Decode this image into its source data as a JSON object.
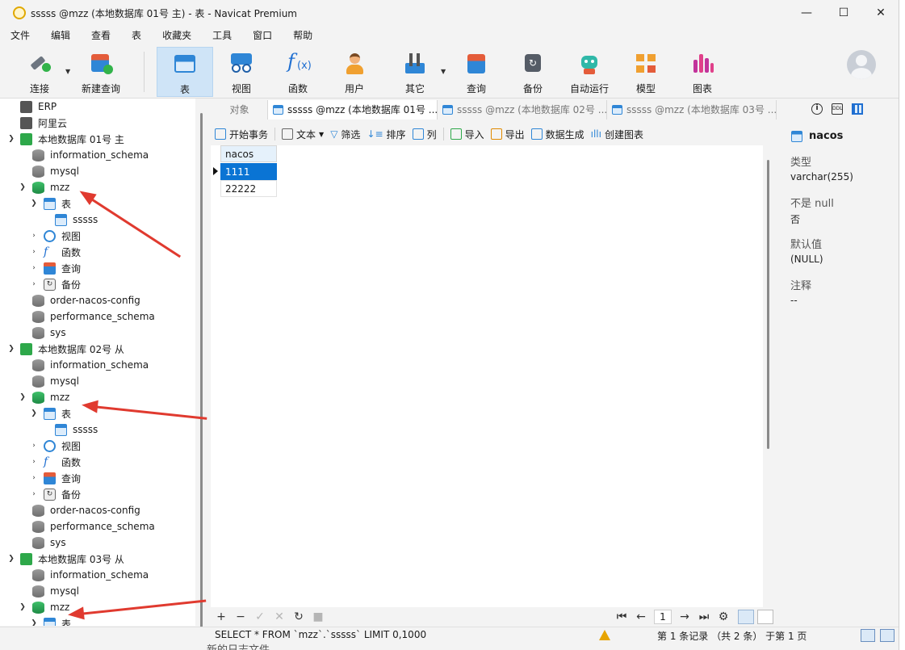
{
  "window": {
    "title": "sssss @mzz (本地数据库 01号 主) - 表 - Navicat Premium",
    "controls": {
      "minimize": "—",
      "maximize": "☐",
      "close": "✕"
    }
  },
  "menu": [
    "文件",
    "编辑",
    "查看",
    "表",
    "收藏夹",
    "工具",
    "窗口",
    "帮助"
  ],
  "toolbar": {
    "connect": "连接",
    "new_query": "新建查询",
    "table": "表",
    "view": "视图",
    "function": "函数",
    "user": "用户",
    "other": "其它",
    "query": "查询",
    "backup": "备份",
    "automation": "自动运行",
    "model": "模型",
    "chart": "图表"
  },
  "tree": {
    "erp": "ERP",
    "aliyun": "阿里云",
    "c1": "本地数据库 01号 主",
    "c2": "本地数据库 02号 从",
    "c3": "本地数据库 03号 从",
    "information_schema": "information_schema",
    "mysql": "mysql",
    "mzz": "mzz",
    "tables": "表",
    "sssss": "sssss",
    "views": "视图",
    "functions": "函数",
    "queries": "查询",
    "backups": "备份",
    "order_nacos_config": "order-nacos-config",
    "performance_schema": "performance_schema",
    "sys": "sys"
  },
  "tabs": [
    {
      "label": "对象"
    },
    {
      "label": "sssss @mzz (本地数据库 01号 ..."
    },
    {
      "label": "sssss @mzz (本地数据库 02号 ..."
    },
    {
      "label": "sssss @mzz (本地数据库 03号 ..."
    }
  ],
  "object_toolbar": {
    "begin_tx": "开始事务",
    "text": "文本",
    "filter": "筛选",
    "sort": "排序",
    "columns": "列",
    "import": "导入",
    "export": "导出",
    "data_gen": "数据生成",
    "create_chart": "创建图表"
  },
  "grid": {
    "header": "nacos",
    "rows": [
      "1111",
      "22222"
    ]
  },
  "grid_bar": {
    "add": "+",
    "remove": "−",
    "apply": "✓",
    "discard": "✕",
    "refresh": "↻",
    "stop": "■",
    "first": "⏮",
    "prev": "←",
    "page": "1",
    "next": "→",
    "last": "⏭",
    "settings": "⚙"
  },
  "status": {
    "sql": "SELECT * FROM `mzz`.`sssss` LIMIT 0,1000",
    "records": "第 1 条记录 （共 2 条） 于第 1 页"
  },
  "bleed_text": "新的日志文件。",
  "right_panel": {
    "field_name": "nacos",
    "type_label": "类型",
    "type_value": "varchar(255)",
    "notnull_label": "不是 null",
    "notnull_value": "否",
    "default_label": "默认值",
    "default_value": "(NULL)",
    "comment_label": "注释",
    "comment_value": "--",
    "icons": [
      "info-icon",
      "ddl-icon",
      "grid-icon"
    ]
  },
  "colors": {
    "accent": "#0a74d4",
    "toolbar_active": "#cfe4f7",
    "annotation_arrow": "#e03a2f"
  }
}
